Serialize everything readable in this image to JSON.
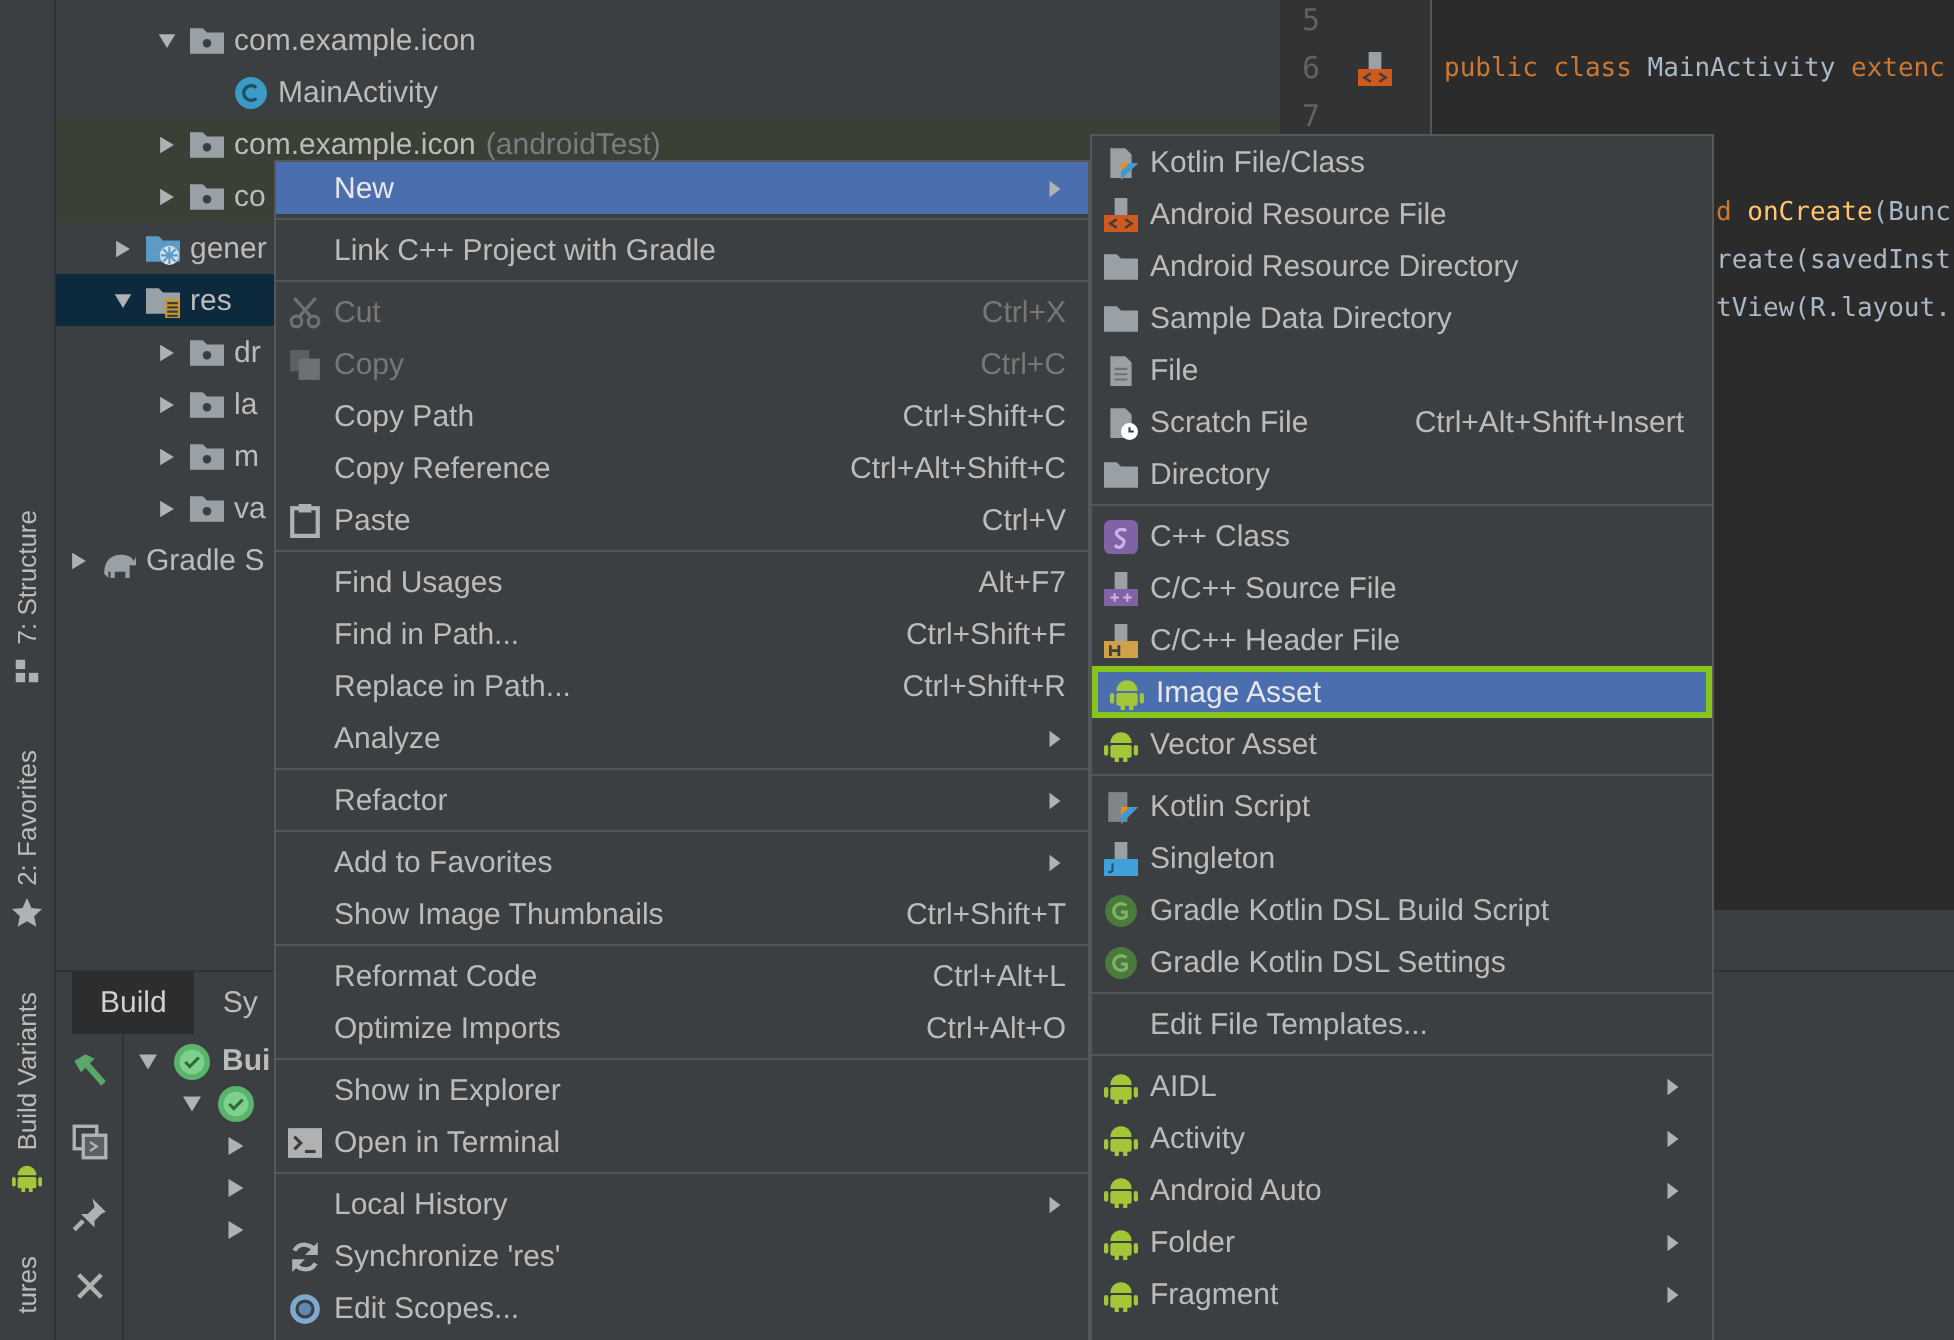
{
  "tool_strip": [
    {
      "label": "7: Structure",
      "kind": "structure"
    },
    {
      "label": "2: Favorites",
      "kind": "favorites"
    },
    {
      "label": "Build Variants",
      "kind": "android"
    },
    {
      "label": "tures",
      "kind": "none"
    }
  ],
  "project_tree": [
    {
      "children": [
        {
          "children": [
            {
              "label": "com.example.icon",
              "kind": "package",
              "expanded": true,
              "selected": false,
              "children": [
                {
                  "label": "MainActivity",
                  "kind": "class",
                  "selected": false
                }
              ]
            },
            {
              "label": "com.example.icon",
              "note": "(androidTest)",
              "kind": "test-package",
              "expanded": false,
              "selected": false
            },
            {
              "label": "co",
              "kind": "test-package",
              "expanded": false,
              "selected": false
            }
          ]
        },
        {
          "label": "gener",
          "kind": "generated-folder",
          "expanded": false,
          "selected": false
        },
        {
          "label": "res",
          "kind": "res-folder",
          "expanded": true,
          "selected": true,
          "children": [
            {
              "label": "dr",
              "kind": "package",
              "expanded": false,
              "selected": false
            },
            {
              "label": "la",
              "kind": "package",
              "expanded": false,
              "selected": false
            },
            {
              "label": "m",
              "kind": "package",
              "expanded": false,
              "selected": false
            },
            {
              "label": "va",
              "kind": "package",
              "expanded": false,
              "selected": false
            }
          ]
        }
      ]
    },
    {
      "label": "Gradle S",
      "kind": "gradle",
      "expanded": false,
      "selected": false
    }
  ],
  "editor": {
    "lines": [
      {
        "number": "5"
      },
      {
        "number": "6",
        "gutter_icon": true,
        "tail": false,
        "tokens": [
          {
            "text": "public class ",
            "kind": "keyword"
          },
          {
            "text": "MainActivity ",
            "kind": "plain"
          },
          {
            "text": "extenc",
            "kind": "keyword"
          }
        ]
      },
      {
        "number": "7"
      },
      {
        "tail": true,
        "tokens": [
          {
            "text": "d ",
            "kind": "keyword"
          },
          {
            "text": "onCreate",
            "kind": "method"
          },
          {
            "text": "(Bunc",
            "kind": "plain"
          }
        ]
      },
      {
        "tail": true,
        "tokens": [
          {
            "text": "reate(savedInst",
            "kind": "plain"
          }
        ]
      },
      {
        "tail": true,
        "tokens": [
          {
            "text": "tView(R.layout.",
            "kind": "plain"
          }
        ]
      }
    ]
  },
  "build_panel": {
    "tabs": [
      {
        "label": "Build",
        "selected": true
      },
      {
        "label": "Sy",
        "selected": false
      }
    ],
    "tools": [
      {
        "kind": "hammer"
      },
      {
        "kind": "rerun"
      },
      {
        "kind": "pin"
      },
      {
        "kind": "close"
      }
    ],
    "tree": [
      {
        "label": "Bui",
        "ok": true,
        "expanded": true,
        "children": [
          {
            "ok": true,
            "expanded": true,
            "children": [
              {
                "expanded": false
              },
              {
                "expanded": false
              },
              {
                "expanded": false
              }
            ]
          }
        ]
      }
    ]
  },
  "context_menu": {
    "groups": [
      [
        {
          "label": "New",
          "kind": "none",
          "selected": true,
          "disabled": false,
          "submenu": true
        }
      ],
      [
        {
          "label": "Link C++ Project with Gradle",
          "kind": "none",
          "selected": false,
          "disabled": false,
          "submenu": false
        }
      ],
      [
        {
          "label": "Cut",
          "shortcut": "Ctrl+X",
          "kind": "scissors",
          "selected": false,
          "disabled": true,
          "submenu": false
        },
        {
          "label": "Copy",
          "shortcut": "Ctrl+C",
          "kind": "copy",
          "selected": false,
          "disabled": true,
          "submenu": false
        },
        {
          "label": "Copy Path",
          "shortcut": "Ctrl+Shift+C",
          "kind": "none",
          "selected": false,
          "disabled": false,
          "submenu": false
        },
        {
          "label": "Copy Reference",
          "shortcut": "Ctrl+Alt+Shift+C",
          "kind": "none",
          "selected": false,
          "disabled": false,
          "submenu": false
        },
        {
          "label": "Paste",
          "shortcut": "Ctrl+V",
          "kind": "paste",
          "selected": false,
          "disabled": false,
          "submenu": false
        }
      ],
      [
        {
          "label": "Find Usages",
          "shortcut": "Alt+F7",
          "kind": "none",
          "selected": false,
          "disabled": false,
          "submenu": false
        },
        {
          "label": "Find in Path...",
          "shortcut": "Ctrl+Shift+F",
          "kind": "none",
          "selected": false,
          "disabled": false,
          "submenu": false
        },
        {
          "label": "Replace in Path...",
          "shortcut": "Ctrl+Shift+R",
          "kind": "none",
          "selected": false,
          "disabled": false,
          "submenu": false
        },
        {
          "label": "Analyze",
          "kind": "none",
          "selected": false,
          "disabled": false,
          "submenu": true
        }
      ],
      [
        {
          "label": "Refactor",
          "kind": "none",
          "selected": false,
          "disabled": false,
          "submenu": true
        }
      ],
      [
        {
          "label": "Add to Favorites",
          "kind": "none",
          "selected": false,
          "disabled": false,
          "submenu": true
        },
        {
          "label": "Show Image Thumbnails",
          "shortcut": "Ctrl+Shift+T",
          "kind": "none",
          "selected": false,
          "disabled": false,
          "submenu": false
        }
      ],
      [
        {
          "label": "Reformat Code",
          "shortcut": "Ctrl+Alt+L",
          "kind": "none",
          "selected": false,
          "disabled": false,
          "submenu": false
        },
        {
          "label": "Optimize Imports",
          "shortcut": "Ctrl+Alt+O",
          "kind": "none",
          "selected": false,
          "disabled": false,
          "submenu": false
        }
      ],
      [
        {
          "label": "Show in Explorer",
          "kind": "none",
          "selected": false,
          "disabled": false,
          "submenu": false
        },
        {
          "label": "Open in Terminal",
          "kind": "terminal",
          "selected": false,
          "disabled": false,
          "submenu": false
        }
      ],
      [
        {
          "label": "Local History",
          "kind": "none",
          "selected": false,
          "disabled": false,
          "submenu": true
        },
        {
          "label": "Synchronize 'res'",
          "kind": "sync",
          "selected": false,
          "disabled": false,
          "submenu": false
        },
        {
          "label": "Edit Scopes...",
          "kind": "scope",
          "selected": false,
          "disabled": false,
          "submenu": false
        }
      ]
    ]
  },
  "new_submenu": {
    "groups": [
      [
        {
          "label": "Kotlin File/Class",
          "kind": "kotlin",
          "selected": false,
          "outlined": false,
          "submenu": false
        },
        {
          "label": "Android Resource File",
          "kind": "resource",
          "selected": false,
          "outlined": false,
          "submenu": false
        },
        {
          "label": "Android Resource Directory",
          "kind": "folder",
          "selected": false,
          "outlined": false,
          "submenu": false
        },
        {
          "label": "Sample Data Directory",
          "kind": "folder",
          "selected": false,
          "outlined": false,
          "submenu": false
        },
        {
          "label": "File",
          "kind": "file",
          "selected": false,
          "outlined": false,
          "submenu": false
        },
        {
          "label": "Scratch File",
          "shortcut": "Ctrl+Alt+Shift+Insert",
          "kind": "scratch",
          "selected": false,
          "outlined": false,
          "submenu": false
        },
        {
          "label": "Directory",
          "kind": "folder",
          "selected": false,
          "outlined": false,
          "submenu": false
        }
      ],
      [
        {
          "label": "C++ Class",
          "kind": "cpp-class",
          "selected": false,
          "outlined": false,
          "submenu": false
        },
        {
          "label": "C/C++ Source File",
          "kind": "cpp-source",
          "selected": false,
          "outlined": false,
          "submenu": false
        },
        {
          "label": "C/C++ Header File",
          "kind": "cpp-header",
          "selected": false,
          "outlined": false,
          "submenu": false
        },
        {
          "label": "Image Asset",
          "kind": "android",
          "selected": true,
          "outlined": true,
          "submenu": false
        },
        {
          "label": "Vector Asset",
          "kind": "android",
          "selected": false,
          "outlined": false,
          "submenu": false
        }
      ],
      [
        {
          "label": "Kotlin Script",
          "kind": "kotlin-script",
          "selected": false,
          "outlined": false,
          "submenu": false
        },
        {
          "label": "Singleton",
          "kind": "singleton",
          "selected": false,
          "outlined": false,
          "submenu": false
        },
        {
          "label": "Gradle Kotlin DSL Build Script",
          "kind": "gradle",
          "selected": false,
          "outlined": false,
          "submenu": false
        },
        {
          "label": "Gradle Kotlin DSL Settings",
          "kind": "gradle",
          "selected": false,
          "outlined": false,
          "submenu": false
        }
      ],
      [
        {
          "label": "Edit File Templates...",
          "kind": "none",
          "selected": false,
          "outlined": false,
          "submenu": false
        }
      ],
      [
        {
          "label": "AIDL",
          "kind": "android",
          "selected": false,
          "outlined": false,
          "submenu": true
        },
        {
          "label": "Activity",
          "kind": "android",
          "selected": false,
          "outlined": false,
          "submenu": true
        },
        {
          "label": "Android Auto",
          "kind": "android",
          "selected": false,
          "outlined": false,
          "submenu": true
        },
        {
          "label": "Folder",
          "kind": "android",
          "selected": false,
          "outlined": false,
          "submenu": true
        },
        {
          "label": "Fragment",
          "kind": "android",
          "selected": false,
          "outlined": false,
          "submenu": true
        }
      ]
    ]
  }
}
